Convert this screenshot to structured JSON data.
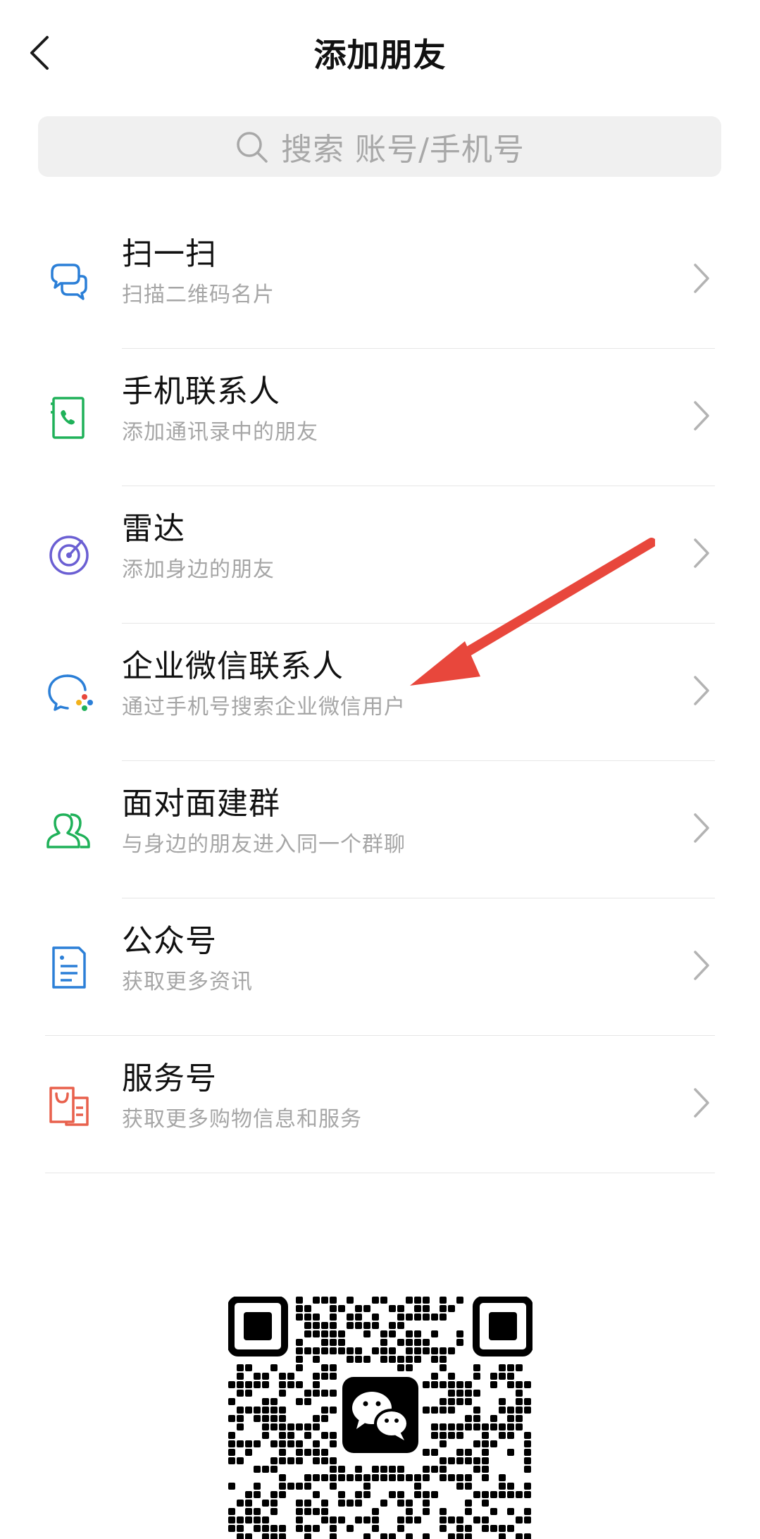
{
  "header": {
    "title": "添加朋友"
  },
  "search": {
    "placeholder": "搜索 账号/手机号"
  },
  "menu": {
    "items": [
      {
        "id": "scan",
        "title": "扫一扫",
        "subtitle": "扫描二维码名片",
        "icon": "scan-icon",
        "color": "#2b7fd7"
      },
      {
        "id": "phone-contacts",
        "title": "手机联系人",
        "subtitle": "添加通讯录中的朋友",
        "icon": "phone-contact-icon",
        "color": "#1fb159"
      },
      {
        "id": "radar",
        "title": "雷达",
        "subtitle": "添加身边的朋友",
        "icon": "radar-icon",
        "color": "#6b5fd3"
      },
      {
        "id": "wecom-contacts",
        "title": "企业微信联系人",
        "subtitle": "通过手机号搜索企业微信用户",
        "icon": "wecom-icon",
        "color": "#2b7fd7"
      },
      {
        "id": "face-to-face-group",
        "title": "面对面建群",
        "subtitle": "与身边的朋友进入同一个群聊",
        "icon": "group-people-icon",
        "color": "#1fb159"
      },
      {
        "id": "official-accounts",
        "title": "公众号",
        "subtitle": "获取更多资讯",
        "icon": "official-account-icon",
        "color": "#2b7fd7"
      },
      {
        "id": "service-accounts",
        "title": "服务号",
        "subtitle": "获取更多购物信息和服务",
        "icon": "shopping-bag-icon",
        "color": "#e8604c"
      }
    ]
  },
  "annotation": {
    "arrow_color": "#e8473c"
  }
}
